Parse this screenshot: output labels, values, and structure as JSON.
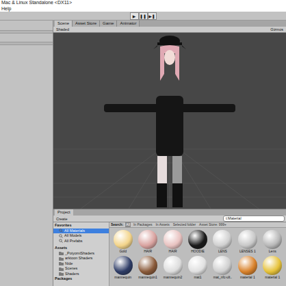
{
  "window": {
    "title": "Mac & Linux Standalone <DX11>"
  },
  "menu": [
    "Help"
  ],
  "toolbar": {
    "buttons": [
      "▶",
      "❚❚",
      "▶❚"
    ]
  },
  "scene": {
    "tabs": [
      {
        "label": "Scene",
        "selected": true
      },
      {
        "label": "Asset Store",
        "selected": false
      },
      {
        "label": "Game",
        "selected": false
      },
      {
        "label": "Animator",
        "selected": false
      }
    ],
    "shading": "Shaded",
    "gizmos": "Gizmos"
  },
  "project": {
    "tab": "Project",
    "create": "Create",
    "search": "t:Material",
    "favorites": {
      "label": "Favorites",
      "items": [
        {
          "label": "All Materials",
          "selected": true
        },
        {
          "label": "All Models",
          "selected": false
        },
        {
          "label": "All Prefabs",
          "selected": false
        }
      ]
    },
    "assets": {
      "label": "Assets",
      "items": [
        "_PoiyomiShaders",
        "arktoon Shaders",
        "Nide",
        "Scenes",
        "Shaders"
      ]
    },
    "packages": "Packages",
    "filters": {
      "label": "Search:",
      "items": [
        {
          "label": "All",
          "selected": true
        },
        {
          "label": "In Packages",
          "selected": false
        },
        {
          "label": "In Assets",
          "selected": false
        },
        {
          "label": "Selected folder",
          "selected": false
        },
        {
          "label": "Asset Store: 999+",
          "selected": false
        }
      ]
    },
    "materials": [
      {
        "name": "Gold",
        "color": "#f3d48a"
      },
      {
        "name": "HAIR",
        "color": "#d9a3a0"
      },
      {
        "name": "HAIR",
        "color": "#e8c2c0"
      },
      {
        "name": "HOODIE",
        "color": "#1a1a1a"
      },
      {
        "name": "LENS",
        "color": "#d0d0d0"
      },
      {
        "name": "LENSES 1",
        "color": "#c8c8c8"
      },
      {
        "name": "Lens",
        "color": "#b8b8b8"
      },
      {
        "name": "mannequin",
        "color": "#2e3c66"
      },
      {
        "name": "mannequin1",
        "color": "#8a5a3a"
      },
      {
        "name": "mannequin2",
        "color": "#dcdcdc"
      },
      {
        "name": "mat1",
        "color": "#e0e0e0"
      },
      {
        "name": "mat_nfc-ult..",
        "color": "#cfcfcf"
      },
      {
        "name": "material 1",
        "color": "#d9822b"
      },
      {
        "name": "material 1",
        "color": "#e6c23a"
      }
    ]
  }
}
